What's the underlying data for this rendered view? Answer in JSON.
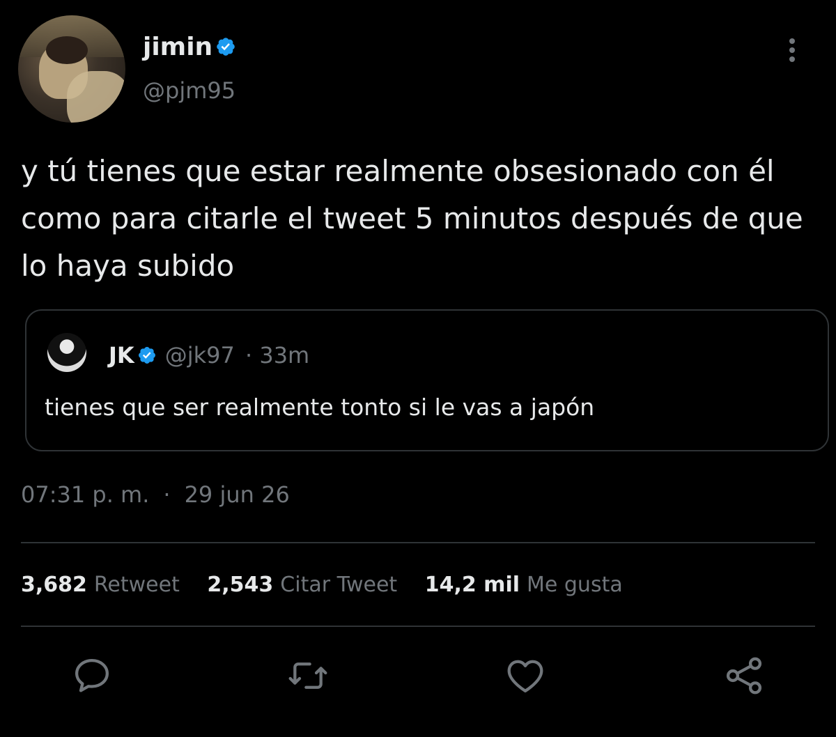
{
  "tweet": {
    "author": {
      "display_name": "jimin",
      "handle": "@pjm95"
    },
    "text": "y tú tienes que estar realmente obsesionado con él como para citarle el tweet 5 minutos después de que lo haya subido",
    "timestamp": "07:31 p. m.",
    "separator": "·",
    "date": "29 jun 26"
  },
  "quoted_tweet": {
    "display_name": "JK",
    "handle": "@jk97",
    "age": "· 33m",
    "text": "tienes que ser realmente tonto si le vas a japón"
  },
  "stats": [
    {
      "count": "3,682",
      "label": "Retweet"
    },
    {
      "count": "2,543",
      "label": "Citar Tweet"
    },
    {
      "count": "14,2 mil",
      "label": "Me gusta"
    }
  ],
  "icons": {
    "verified": "verified-badge-icon",
    "more": "more-vertical-icon",
    "reply": "reply-icon",
    "retweet": "retweet-icon",
    "like": "heart-icon",
    "share": "share-icon"
  },
  "colors": {
    "background": "#000000",
    "text": "#e7e9ea",
    "muted": "#71767b",
    "verified": "#1d9bf0",
    "border": "#2f3336"
  }
}
